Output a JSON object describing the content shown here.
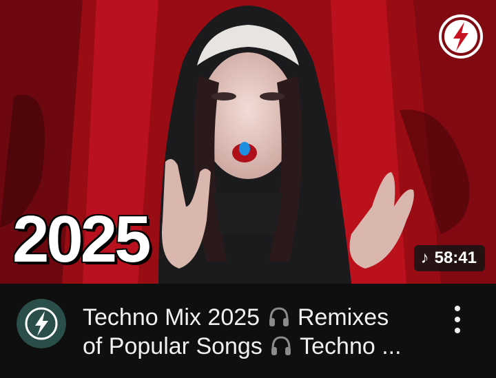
{
  "video": {
    "year_text": "2025",
    "duration": "58:41",
    "title_line1_a": "Techno Mix 2025",
    "title_line1_b": "Remixes",
    "title_line2_a": "of Popular Songs",
    "title_line2_b": "Techno ..."
  },
  "icons": {
    "channel_logo": "lightning-bolt-icon",
    "duration_note": "music-note-icon",
    "title_emoji": "headphones-icon",
    "menu": "kebab-menu-icon"
  },
  "colors": {
    "background": "#0f0f0f",
    "thumbnail_red": "#b0101a",
    "channel_teal": "#2a4e4a",
    "text": "#f1f1f1"
  }
}
